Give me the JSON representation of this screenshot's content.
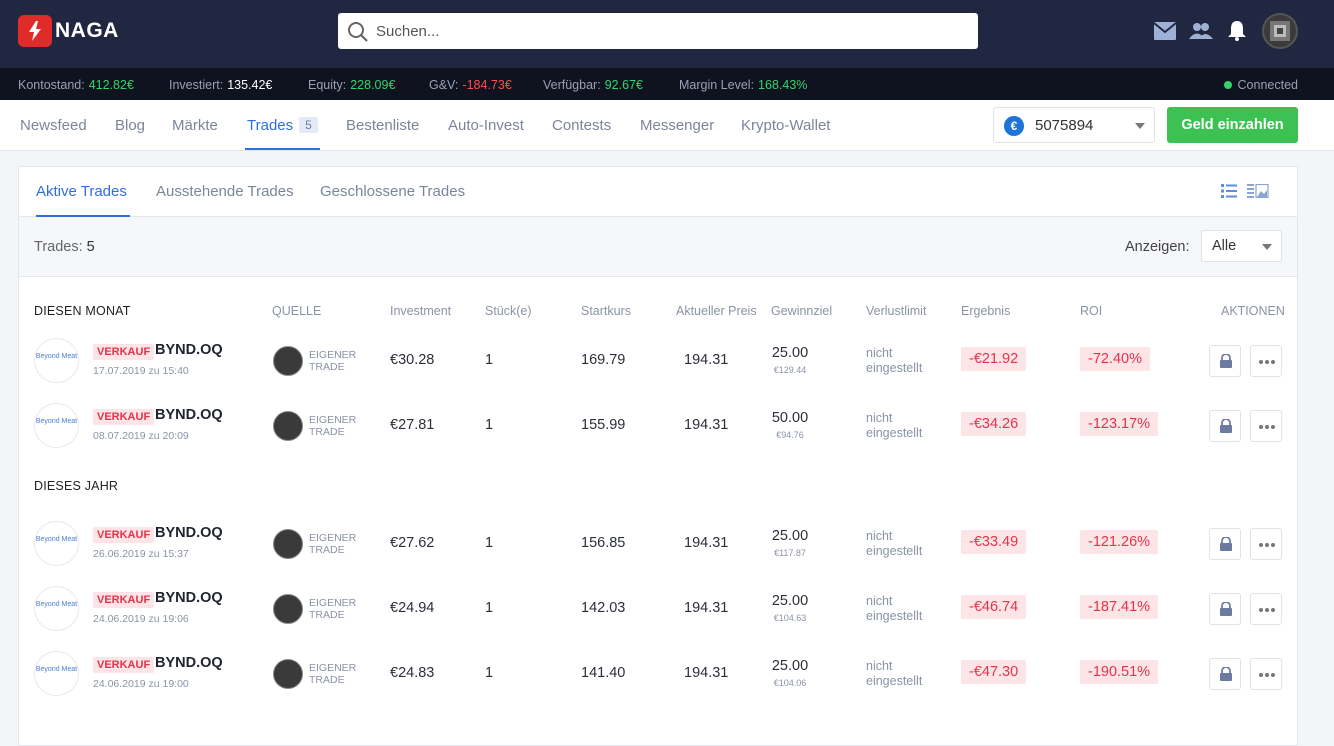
{
  "app": {
    "name": "NAGA"
  },
  "search": {
    "placeholder": "Suchen..."
  },
  "status": {
    "balance_label": "Kontostand:",
    "balance": "412.82€",
    "invested_label": "Investiert:",
    "invested": "135.42€",
    "equity_label": "Equity:",
    "equity": "228.09€",
    "pl_label": "G&V:",
    "pl": "-184.73€",
    "available_label": "Verfügbar:",
    "available": "92.67€",
    "margin_label": "Margin Level:",
    "margin": "168.43%",
    "connection": "Connected"
  },
  "nav": {
    "items": [
      "Newsfeed",
      "Blog",
      "Märkte",
      "Trades",
      "Bestenliste",
      "Auto-Invest",
      "Contests",
      "Messenger",
      "Krypto-Wallet"
    ],
    "trades_badge": "5",
    "account_currency_symbol": "€",
    "account_number": "5075894",
    "deposit_label": "Geld einzahlen"
  },
  "subtabs": [
    "Aktive Trades",
    "Ausstehende Trades",
    "Geschlossene Trades"
  ],
  "filter": {
    "trades_label": "Trades:",
    "trades_count": "5",
    "show_label": "Anzeigen:",
    "show_value": "Alle"
  },
  "table": {
    "headers": [
      "DIESEN MONAT",
      "QUELLE",
      "Investment",
      "Stück(e)",
      "Startkurs",
      "Aktueller Preis",
      "Gewinnziel",
      "Verlustlimit",
      "Ergebnis",
      "ROI",
      "AKTIONEN"
    ],
    "section2": "DIESES JAHR",
    "rows": [
      {
        "logo": "Beyond Meat",
        "side": "VERKAUF",
        "symbol": "BYND.OQ",
        "date": "17.07.2019 zu 15:40",
        "source": "EIGENER TRADE",
        "investment": "€30.28",
        "units": "1",
        "start": "169.79",
        "current": "194.31",
        "tp": "25.00",
        "tp_sub": "€129.44",
        "sl": "nicht eingestellt",
        "result": "-€21.92",
        "roi": "-72.40%"
      },
      {
        "logo": "Beyond Meat",
        "side": "VERKAUF",
        "symbol": "BYND.OQ",
        "date": "08.07.2019 zu 20:09",
        "source": "EIGENER TRADE",
        "investment": "€27.81",
        "units": "1",
        "start": "155.99",
        "current": "194.31",
        "tp": "50.00",
        "tp_sub": "€94.76",
        "sl": "nicht eingestellt",
        "result": "-€34.26",
        "roi": "-123.17%"
      },
      {
        "logo": "Beyond Meat",
        "side": "VERKAUF",
        "symbol": "BYND.OQ",
        "date": "26.06.2019 zu 15:37",
        "source": "EIGENER TRADE",
        "investment": "€27.62",
        "units": "1",
        "start": "156.85",
        "current": "194.31",
        "tp": "25.00",
        "tp_sub": "€117.87",
        "sl": "nicht eingestellt",
        "result": "-€33.49",
        "roi": "-121.26%"
      },
      {
        "logo": "Beyond Meat",
        "side": "VERKAUF",
        "symbol": "BYND.OQ",
        "date": "24.06.2019 zu 19:06",
        "source": "EIGENER TRADE",
        "investment": "€24.94",
        "units": "1",
        "start": "142.03",
        "current": "194.31",
        "tp": "25.00",
        "tp_sub": "€104.63",
        "sl": "nicht eingestellt",
        "result": "-€46.74",
        "roi": "-187.41%"
      },
      {
        "logo": "Beyond Meat",
        "side": "VERKAUF",
        "symbol": "BYND.OQ",
        "date": "24.06.2019 zu 19:00",
        "source": "EIGENER TRADE",
        "investment": "€24.83",
        "units": "1",
        "start": "141.40",
        "current": "194.31",
        "tp": "25.00",
        "tp_sub": "€104.06",
        "sl": "nicht eingestellt",
        "result": "-€47.30",
        "roi": "-190.51%"
      }
    ]
  },
  "colors": {
    "accent": "#2f6fe0",
    "positive": "#35d36a",
    "negative": "#e5334b",
    "topbar": "#222741",
    "deposit": "#3cc152"
  }
}
